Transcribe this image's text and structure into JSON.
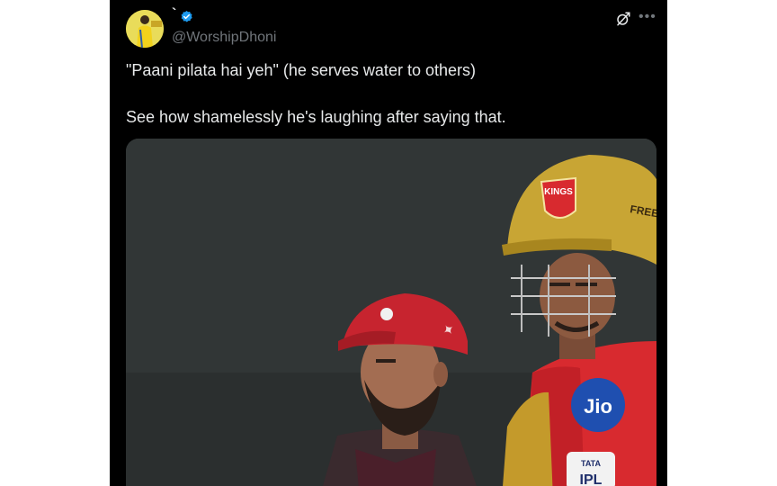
{
  "tweet": {
    "display_name": "`",
    "handle": "@WorshipDhoni",
    "text_line1": "\"Paani pilata hai yeh\" (he serves water to others)",
    "text_line2": "See how shamelessly he's laughing after saying that."
  },
  "media": {
    "helmet_logo_text": "KINGS",
    "helmet_side_text": "FREE",
    "jersey_sponsor_text": "Jio",
    "jersey_badge_text": "TATA",
    "jersey_badge_sub": "IPL"
  },
  "icons": {
    "verified": "verified-badge-icon",
    "grok": "grok-icon",
    "more": "more-icon"
  },
  "colors": {
    "background": "#000000",
    "text_primary": "#e7e9ea",
    "text_secondary": "#71767b",
    "verified_blue": "#1d9bf0"
  }
}
